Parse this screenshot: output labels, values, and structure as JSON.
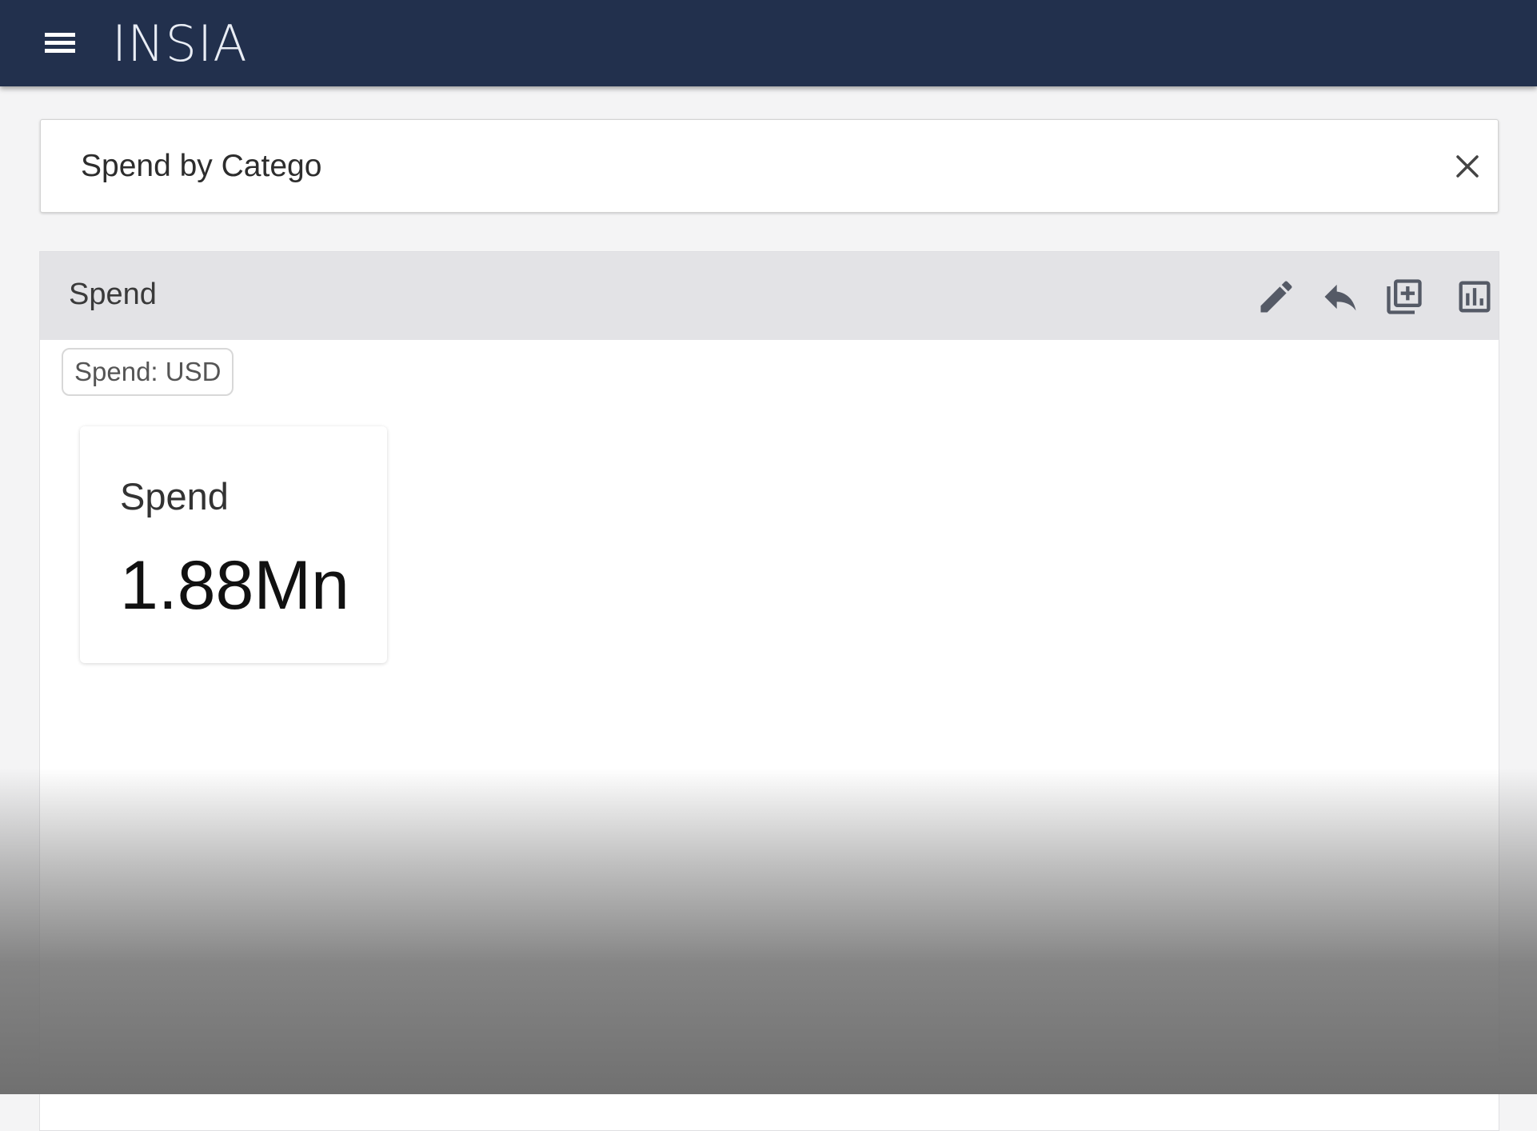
{
  "app": {
    "brand": "INSIA",
    "header_color": "#22304d"
  },
  "search": {
    "value": "Spend by Catego",
    "clear_icon": "close-icon"
  },
  "panel": {
    "title": "Spend",
    "tools": [
      "edit-icon",
      "reply-icon",
      "add-to-collection-icon",
      "chart-icon"
    ],
    "filter_chip": "Spend: USD",
    "kpi": {
      "label": "Spend",
      "value": "1.88Mn"
    }
  }
}
